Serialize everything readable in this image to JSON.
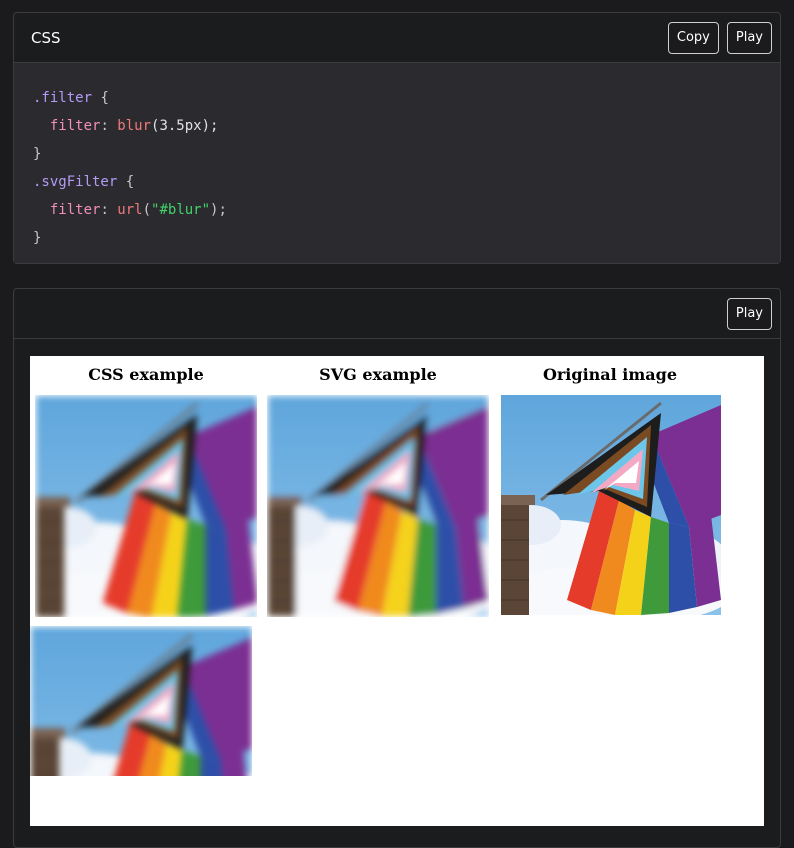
{
  "css_panel": {
    "title": "CSS",
    "copy_label": "Copy",
    "play_label": "Play"
  },
  "code": {
    "line1_selector": ".filter",
    "line1_brace": " {",
    "line2_indent": "  ",
    "line2_prop": "filter",
    "line2_colon": ": ",
    "line2_fn": "blur",
    "line2_args": "(3.5px);",
    "line3": "}",
    "line4_selector": ".svgFilter",
    "line4_brace": " {",
    "line5_indent": "  ",
    "line5_prop": "filter",
    "line5_colon": ": ",
    "line5_fn": "url",
    "line5_open": "(",
    "line5_str": "\"#blur\"",
    "line5_close": ");",
    "line6": "}"
  },
  "play_panel": {
    "play_label": "Play"
  },
  "output": {
    "headings": [
      "CSS example",
      "SVG example",
      "Original image"
    ]
  }
}
